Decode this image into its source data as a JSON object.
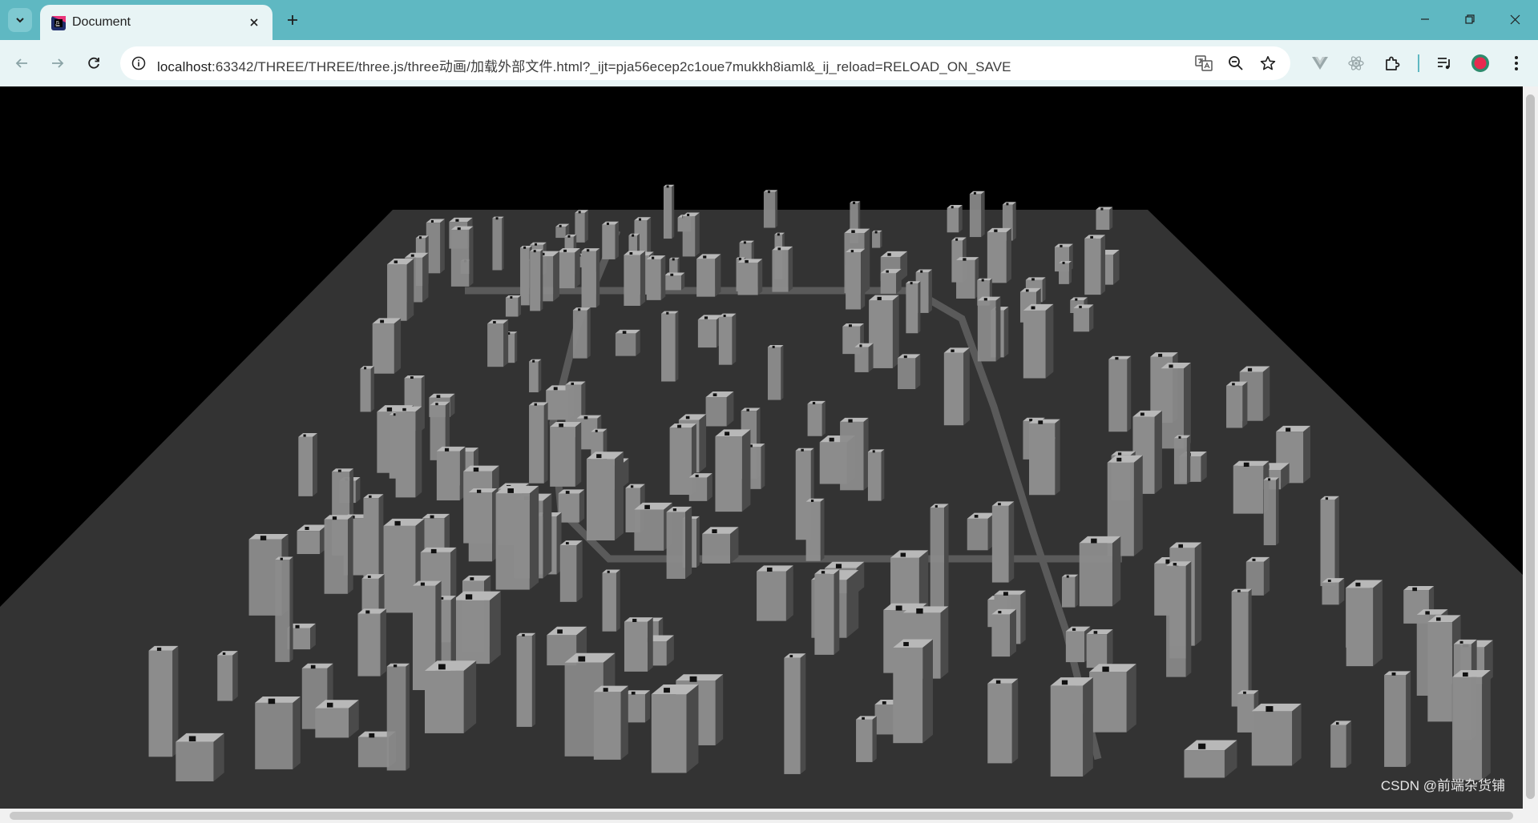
{
  "browser": {
    "tab": {
      "title": "Document",
      "favicon": "webstorm-icon"
    },
    "url_host": "localhost",
    "url_rest": ":63342/THREE/THREE/three.js/three动画/加载外部文件.html?_ijt=pja56ecep2c1oue7mukkh8iaml&_ij_reload=RELOAD_ON_SAVE",
    "accent": "#5fb8c2",
    "toolbar_bg": "#e8f4f5"
  },
  "viewport": {
    "watermark": "CSDN @前端杂货铺",
    "ground_color": "#333333",
    "building_color": "#8c8c8c"
  }
}
